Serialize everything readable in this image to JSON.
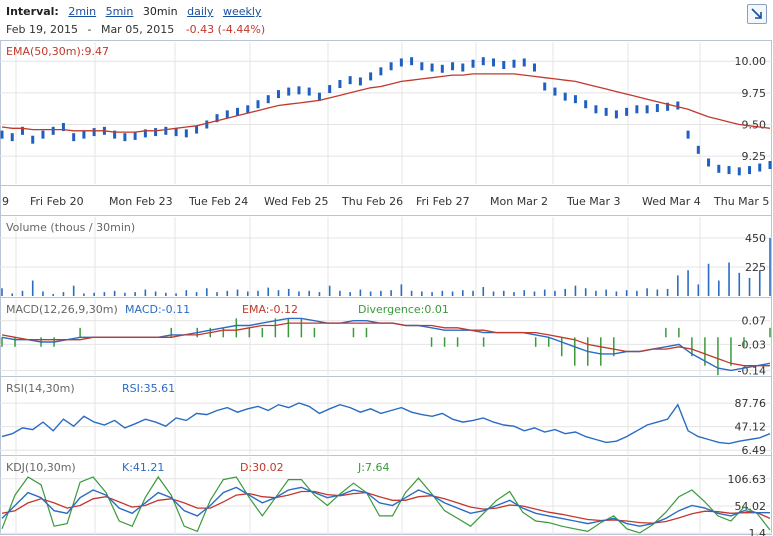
{
  "toolbar": {
    "interval_label": "Interval:",
    "intervals": [
      {
        "label": "2min",
        "current": false
      },
      {
        "label": "5min",
        "current": false
      },
      {
        "label": "30min",
        "current": true
      },
      {
        "label": "daily",
        "current": false
      },
      {
        "label": "weekly",
        "current": false
      }
    ],
    "date_from": "Feb 19, 2015",
    "date_sep": "-",
    "date_to": "Mar 05, 2015",
    "change": "-0.43 (-4.44%)",
    "expand_icon": "expand-arrow-icon"
  },
  "colors": {
    "price": "#1f5fbf",
    "ema": "#c0392b",
    "macd": "#2a6cc4",
    "macd_ema": "#c0392b",
    "divergence": "#3a9a3a",
    "rsi": "#2a6cc4",
    "k": "#2a6cc4",
    "d": "#c0392b",
    "j": "#3a9a3a",
    "volume": "#2a6cc4",
    "grid": "#e4e4e4",
    "border": "#b9c4d4"
  },
  "chart_data": [
    {
      "type": "line",
      "panel": "price",
      "title": "EMA(50,30m):9.47",
      "x_labels": [
        "9",
        "Fri Feb 20",
        "Mon Feb 23",
        "Tue Feb 24",
        "Wed Feb 25",
        "Thu Feb 26",
        "Fri Feb 27",
        "Mon Mar 2",
        "Tue Mar 3",
        "Wed Mar 4",
        "Thu Mar 5"
      ],
      "y_ticks": [
        "10.00",
        "9.75",
        "9.50",
        "9.25"
      ],
      "ylim": [
        9.03,
        10.12
      ],
      "series": [
        {
          "name": "Price",
          "values": [
            9.42,
            9.4,
            9.45,
            9.38,
            9.42,
            9.45,
            9.48,
            9.4,
            9.42,
            9.44,
            9.45,
            9.42,
            9.4,
            9.41,
            9.43,
            9.44,
            9.45,
            9.44,
            9.43,
            9.46,
            9.5,
            9.55,
            9.58,
            9.6,
            9.62,
            9.66,
            9.7,
            9.74,
            9.76,
            9.77,
            9.76,
            9.72,
            9.78,
            9.82,
            9.85,
            9.84,
            9.88,
            9.92,
            9.96,
            9.99,
            10.0,
            9.96,
            9.95,
            9.94,
            9.96,
            9.95,
            9.98,
            10.0,
            9.99,
            9.97,
            9.98,
            9.99,
            9.95,
            9.8,
            9.76,
            9.72,
            9.7,
            9.66,
            9.62,
            9.6,
            9.58,
            9.6,
            9.62,
            9.62,
            9.63,
            9.64,
            9.65,
            9.42,
            9.3,
            9.2,
            9.15,
            9.14,
            9.13,
            9.14,
            9.16,
            9.18
          ]
        },
        {
          "name": "EMA",
          "values": [
            9.48,
            9.47,
            9.47,
            9.46,
            9.46,
            9.46,
            9.46,
            9.45,
            9.45,
            9.45,
            9.45,
            9.44,
            9.44,
            9.44,
            9.45,
            9.45,
            9.46,
            9.47,
            9.48,
            9.49,
            9.51,
            9.53,
            9.55,
            9.57,
            9.59,
            9.61,
            9.63,
            9.65,
            9.66,
            9.67,
            9.68,
            9.69,
            9.71,
            9.73,
            9.75,
            9.77,
            9.79,
            9.8,
            9.82,
            9.84,
            9.85,
            9.86,
            9.87,
            9.88,
            9.89,
            9.89,
            9.9,
            9.9,
            9.9,
            9.9,
            9.9,
            9.89,
            9.88,
            9.87,
            9.86,
            9.85,
            9.84,
            9.82,
            9.8,
            9.78,
            9.76,
            9.74,
            9.72,
            9.7,
            9.68,
            9.66,
            9.64,
            9.62,
            9.59,
            9.56,
            9.54,
            9.52,
            9.5,
            9.49,
            9.48,
            9.47
          ]
        }
      ]
    },
    {
      "type": "bar",
      "panel": "volume",
      "title": "Volume (thous / 30min)",
      "y_ticks": [
        "450",
        "225"
      ],
      "ylim": [
        0,
        450
      ],
      "values": [
        60,
        20,
        40,
        120,
        35,
        15,
        30,
        80,
        20,
        25,
        30,
        40,
        25,
        30,
        50,
        35,
        25,
        20,
        45,
        30,
        60,
        30,
        40,
        50,
        35,
        40,
        65,
        45,
        55,
        35,
        40,
        30,
        80,
        40,
        30,
        50,
        35,
        40,
        45,
        90,
        40,
        35,
        30,
        40,
        35,
        45,
        40,
        70,
        35,
        40,
        30,
        45,
        35,
        50,
        40,
        55,
        80,
        60,
        40,
        50,
        35,
        45,
        40,
        60,
        50,
        55,
        160,
        200,
        90,
        250,
        120,
        260,
        180,
        140,
        200,
        450
      ]
    },
    {
      "type": "line",
      "panel": "macd",
      "title": "MACD(12,26,9,30m)",
      "legend": [
        {
          "name": "MACD",
          "label": "MACD:-0.11"
        },
        {
          "name": "EMA",
          "label": "EMA:-0.12"
        },
        {
          "name": "Divergence",
          "label": "Divergence:0.01"
        }
      ],
      "y_ticks": [
        "0.07",
        "-0.03",
        "-0.14"
      ],
      "ylim": [
        -0.155,
        0.09
      ],
      "series": [
        {
          "name": "MACD",
          "values": [
            0.0,
            -0.01,
            -0.01,
            -0.02,
            -0.02,
            -0.01,
            0.0,
            0.0,
            0.0,
            0.0,
            0.0,
            0.0,
            0.0,
            0.01,
            0.01,
            0.02,
            0.03,
            0.04,
            0.05,
            0.05,
            0.06,
            0.07,
            0.08,
            0.08,
            0.07,
            0.06,
            0.06,
            0.07,
            0.07,
            0.06,
            0.06,
            0.05,
            0.05,
            0.04,
            0.03,
            0.03,
            0.03,
            0.02,
            0.02,
            0.02,
            0.02,
            0.01,
            0.0,
            -0.02,
            -0.04,
            -0.06,
            -0.07,
            -0.07,
            -0.06,
            -0.06,
            -0.05,
            -0.04,
            -0.03,
            -0.07,
            -0.1,
            -0.13,
            -0.14,
            -0.13,
            -0.12,
            -0.11
          ]
        },
        {
          "name": "EMA",
          "values": [
            0.01,
            0.0,
            -0.01,
            -0.01,
            -0.01,
            -0.01,
            -0.01,
            0.0,
            0.0,
            0.0,
            0.0,
            0.0,
            0.0,
            0.0,
            0.01,
            0.01,
            0.02,
            0.03,
            0.03,
            0.04,
            0.05,
            0.05,
            0.06,
            0.06,
            0.06,
            0.06,
            0.06,
            0.06,
            0.06,
            0.06,
            0.06,
            0.05,
            0.05,
            0.05,
            0.04,
            0.04,
            0.03,
            0.03,
            0.02,
            0.02,
            0.02,
            0.02,
            0.01,
            0.0,
            -0.01,
            -0.03,
            -0.04,
            -0.05,
            -0.06,
            -0.06,
            -0.05,
            -0.05,
            -0.04,
            -0.05,
            -0.07,
            -0.09,
            -0.11,
            -0.12,
            -0.12,
            -0.12
          ]
        }
      ]
    },
    {
      "type": "line",
      "panel": "rsi",
      "title": "RSI(14,30m)",
      "legend": [
        {
          "name": "RSI",
          "label": "RSI:35.61"
        }
      ],
      "y_ticks": [
        "87.76",
        "47.12",
        "6.49"
      ],
      "ylim": [
        0,
        100
      ],
      "series": [
        {
          "name": "RSI",
          "values": [
            30,
            35,
            45,
            42,
            55,
            40,
            60,
            48,
            65,
            55,
            50,
            58,
            45,
            52,
            60,
            55,
            48,
            62,
            58,
            70,
            68,
            75,
            80,
            72,
            78,
            82,
            75,
            85,
            80,
            88,
            82,
            70,
            78,
            85,
            80,
            72,
            78,
            70,
            75,
            80,
            72,
            68,
            65,
            70,
            60,
            55,
            58,
            62,
            55,
            50,
            48,
            40,
            45,
            38,
            42,
            35,
            38,
            30,
            25,
            20,
            22,
            30,
            40,
            50,
            55,
            60,
            85,
            40,
            30,
            25,
            20,
            18,
            22,
            25,
            28,
            35
          ]
        }
      ]
    },
    {
      "type": "line",
      "panel": "kdj",
      "title": "KDJ(10,30m)",
      "legend": [
        {
          "name": "K",
          "label": "K:41.21"
        },
        {
          "name": "D",
          "label": "D:30.02"
        },
        {
          "name": "J",
          "label": "J:7.64"
        }
      ],
      "y_ticks": [
        "106.63",
        "54.02",
        "1.4"
      ],
      "ylim": [
        -2,
        112
      ],
      "series": [
        {
          "name": "K",
          "values": [
            30,
            55,
            80,
            70,
            45,
            40,
            70,
            85,
            75,
            50,
            40,
            60,
            80,
            70,
            45,
            35,
            55,
            80,
            90,
            75,
            60,
            70,
            85,
            90,
            80,
            70,
            75,
            85,
            80,
            60,
            55,
            70,
            85,
            75,
            60,
            50,
            40,
            45,
            55,
            65,
            50,
            40,
            35,
            30,
            25,
            20,
            25,
            30,
            20,
            15,
            20,
            30,
            45,
            55,
            50,
            40,
            35,
            45,
            41,
            41
          ]
        },
        {
          "name": "D",
          "values": [
            40,
            45,
            60,
            68,
            60,
            50,
            55,
            68,
            72,
            62,
            52,
            55,
            65,
            68,
            60,
            50,
            50,
            62,
            75,
            78,
            72,
            70,
            75,
            82,
            82,
            76,
            74,
            78,
            80,
            72,
            65,
            65,
            72,
            74,
            68,
            60,
            52,
            48,
            50,
            56,
            54,
            48,
            42,
            38,
            33,
            28,
            26,
            27,
            25,
            22,
            21,
            24,
            31,
            39,
            44,
            43,
            40,
            41,
            41,
            30
          ]
        },
        {
          "name": "J",
          "values": [
            10,
            75,
            110,
            95,
            15,
            20,
            100,
            110,
            80,
            25,
            15,
            70,
            110,
            75,
            15,
            5,
            65,
            105,
            110,
            70,
            35,
            70,
            105,
            105,
            75,
            55,
            78,
            98,
            80,
            35,
            35,
            80,
            108,
            78,
            45,
            30,
            15,
            40,
            65,
            82,
            42,
            25,
            22,
            15,
            10,
            5,
            22,
            35,
            10,
            2,
            18,
            42,
            72,
            85,
            62,
            35,
            25,
            52,
            40,
            7.64
          ]
        }
      ]
    }
  ]
}
